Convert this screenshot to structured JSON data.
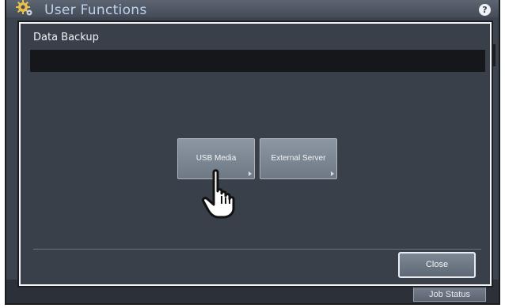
{
  "app": {
    "title": "User Functions",
    "help_label": "?",
    "job_status_label": "Job Status"
  },
  "dialog": {
    "title": "Data Backup",
    "message": "",
    "options": [
      {
        "label": "USB Media"
      },
      {
        "label": "External Server"
      }
    ],
    "close_label": "Close"
  },
  "colors": {
    "background": "#3d4450",
    "title_text": "#bcd3f0",
    "dialog_border": "#f1f3f5",
    "button": "#7e8794"
  },
  "icons": {
    "app": "gear-icon",
    "help": "help-icon",
    "cursor": "hand-pointer-icon"
  }
}
